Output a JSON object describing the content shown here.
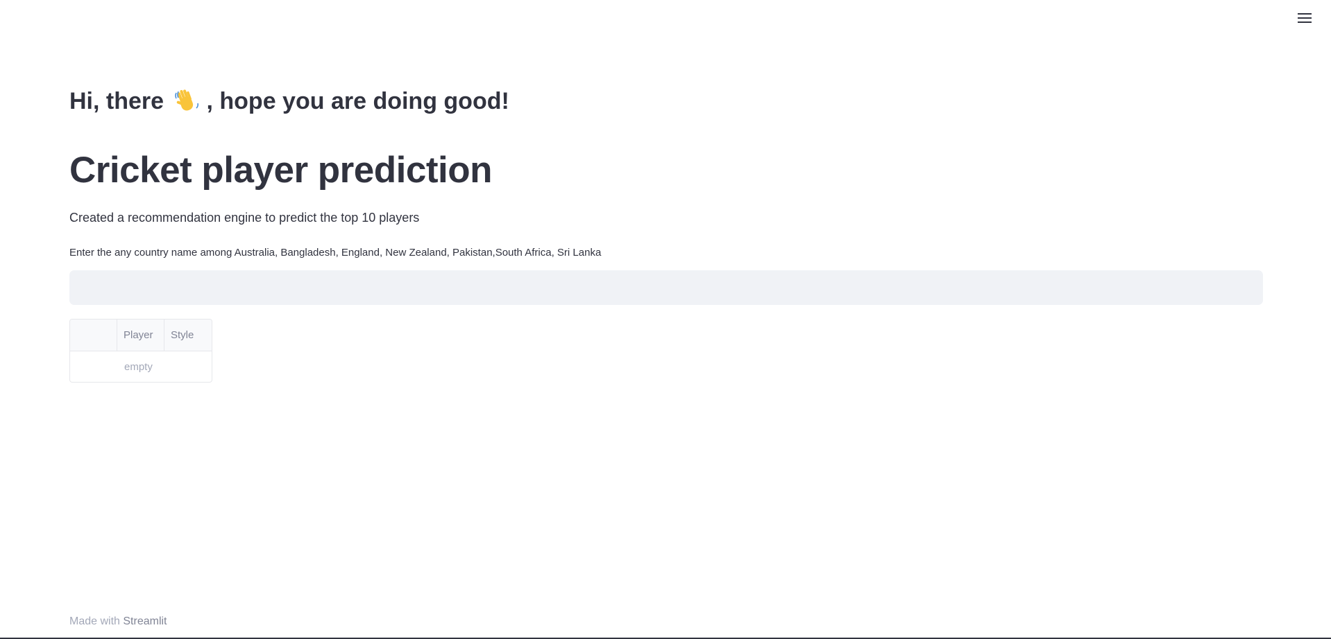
{
  "header": {
    "menu_icon": "hamburger-menu-icon"
  },
  "main": {
    "greeting_before": "Hi, there",
    "greeting_icon": "waving-hand-icon",
    "greeting_after": ", hope you are doing good!",
    "title": "Cricket player prediction",
    "description": "Created a recommendation engine to predict the top 10 players",
    "input": {
      "label": "Enter the any country name among Australia, Bangladesh, England, New Zealand, Pakistan,South Africa, Sri Lanka",
      "value": ""
    },
    "table": {
      "columns": [
        "Player",
        "Style"
      ],
      "empty_text": "empty"
    }
  },
  "footer": {
    "prefix": "Made with",
    "link": "Streamlit"
  },
  "colors": {
    "text": "#31333f",
    "input_background": "#f0f2f6",
    "muted": "#a3a8b8"
  }
}
